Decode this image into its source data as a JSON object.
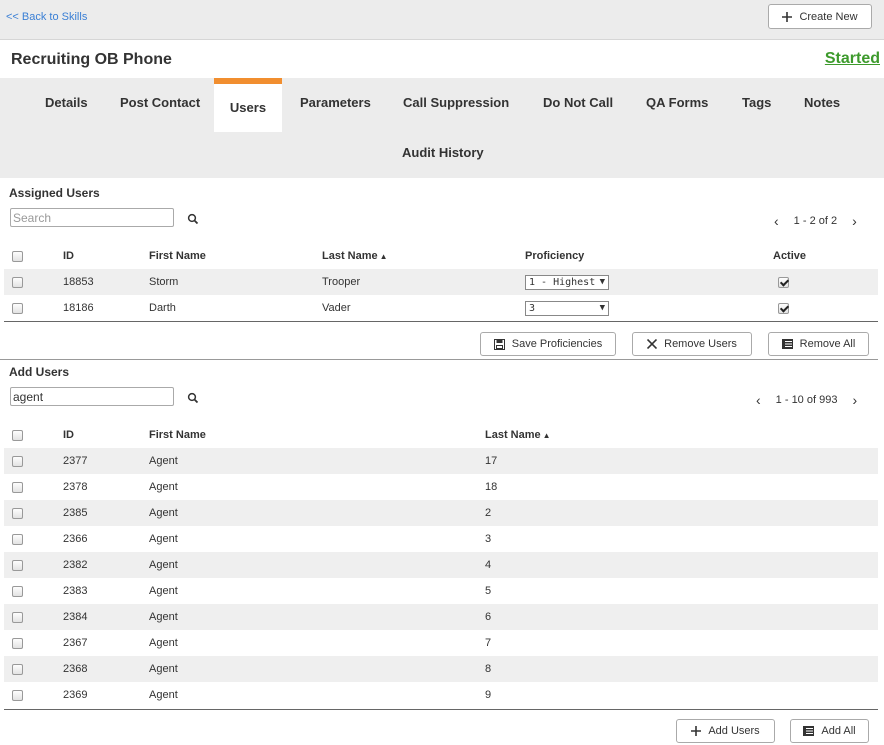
{
  "nav": {
    "back_label": "<< Back to Skills",
    "create_label": "Create New"
  },
  "skill": {
    "title": "Recruiting OB Phone",
    "status": "Started",
    "status_color": "#3d9a2c"
  },
  "tabs": [
    {
      "label": "Details"
    },
    {
      "label": "Post Contact"
    },
    {
      "label": "Users"
    },
    {
      "label": "Parameters"
    },
    {
      "label": "Call Suppression"
    },
    {
      "label": "Do Not Call"
    },
    {
      "label": "QA Forms"
    },
    {
      "label": "Tags"
    },
    {
      "label": "Notes"
    },
    {
      "label": "Audit History"
    }
  ],
  "active_tab": "Users",
  "accent_color": "#f18e2f",
  "assigned": {
    "title": "Assigned Users",
    "search_placeholder": "Search",
    "search_value": "",
    "pager": "1 - 2 of 2",
    "columns": {
      "id": "ID",
      "first": "First Name",
      "last": "Last Name",
      "proficiency": "Proficiency",
      "active": "Active"
    },
    "rows": [
      {
        "id": "18853",
        "first": "Storm",
        "last": "Trooper",
        "proficiency": "1 - Highest",
        "active": true
      },
      {
        "id": "18186",
        "first": "Darth",
        "last": "Vader",
        "proficiency": "3",
        "active": true
      }
    ],
    "buttons": {
      "save": "Save Proficiencies",
      "remove": "Remove Users",
      "remove_all": "Remove All"
    }
  },
  "add": {
    "title": "Add Users",
    "search_value": "agent",
    "pager": "1 - 10 of 993",
    "columns": {
      "id": "ID",
      "first": "First Name",
      "last": "Last Name"
    },
    "rows": [
      {
        "id": "2377",
        "first": "Agent",
        "last": "17"
      },
      {
        "id": "2378",
        "first": "Agent",
        "last": "18"
      },
      {
        "id": "2385",
        "first": "Agent",
        "last": "2"
      },
      {
        "id": "2366",
        "first": "Agent",
        "last": "3"
      },
      {
        "id": "2382",
        "first": "Agent",
        "last": "4"
      },
      {
        "id": "2383",
        "first": "Agent",
        "last": "5"
      },
      {
        "id": "2384",
        "first": "Agent",
        "last": "6"
      },
      {
        "id": "2367",
        "first": "Agent",
        "last": "7"
      },
      {
        "id": "2368",
        "first": "Agent",
        "last": "8"
      },
      {
        "id": "2369",
        "first": "Agent",
        "last": "9"
      }
    ],
    "buttons": {
      "add": "Add Users",
      "add_all": "Add All"
    }
  }
}
